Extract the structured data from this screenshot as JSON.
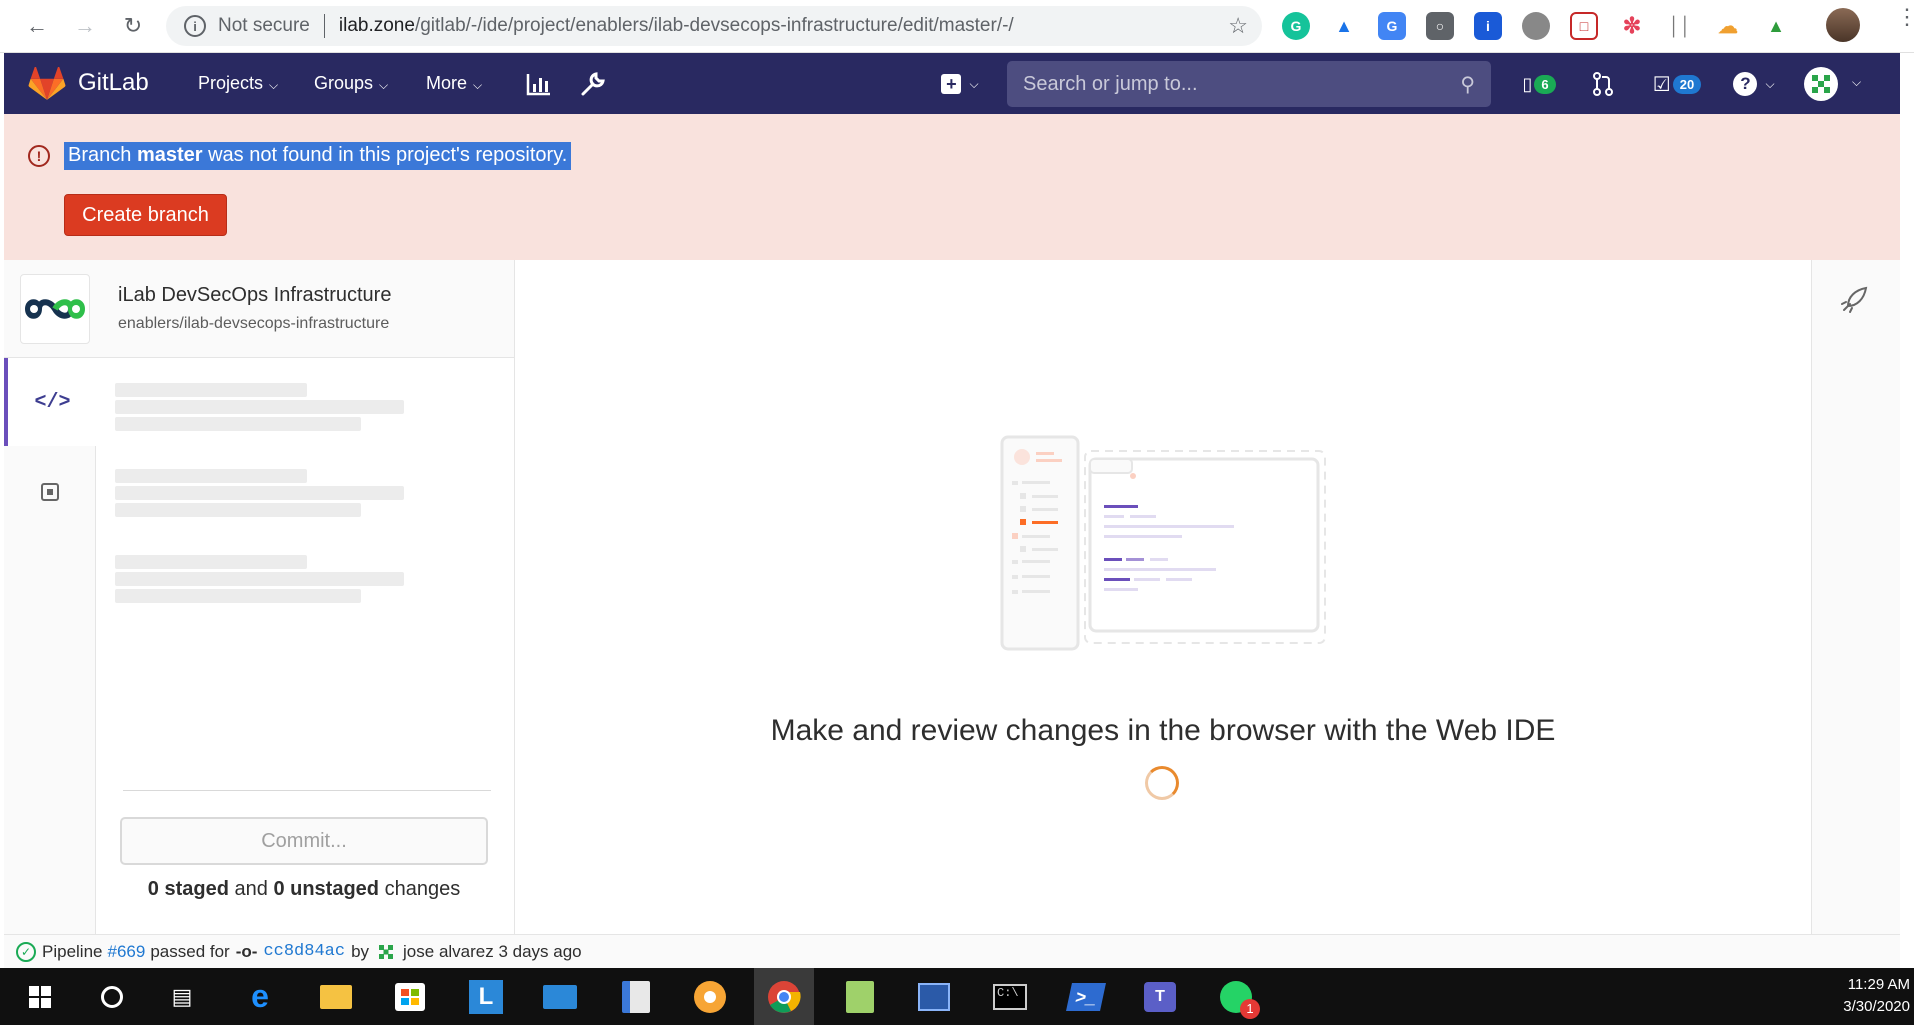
{
  "browser": {
    "security_label": "Not secure",
    "url_host": "ilab.zone",
    "url_path": "/gitlab/-/ide/project/enablers/ilab-devsecops-infrastructure/edit/master/-/"
  },
  "navbar": {
    "brand": "GitLab",
    "menus": [
      "Projects",
      "Groups",
      "More"
    ],
    "search_placeholder": "Search or jump to...",
    "issues_count": "6",
    "todos_count": "20",
    "colors": {
      "background": "#292961",
      "search": "#4d4d80",
      "issues_badge": "#1aaa55",
      "todos_badge": "#1f78d1"
    }
  },
  "alert": {
    "msg_prefix": "Branch ",
    "branch": "master",
    "msg_suffix": " was not found in this project's repository.",
    "button_label": "Create branch",
    "colors": {
      "background": "#f9e2dd",
      "button": "#db3b21"
    }
  },
  "project": {
    "name": "iLab DevSecOps Infrastructure",
    "path": "enablers/ilab-devsecops-infrastructure"
  },
  "sidebar": {
    "items": [
      {
        "name": "edit-icon",
        "active": true
      },
      {
        "name": "review-icon",
        "active": false
      }
    ]
  },
  "commit": {
    "button_label": "Commit...",
    "staged_count": "0 staged",
    "and_text": " and ",
    "unstaged_count": "0 unstaged",
    "changes_text": " changes"
  },
  "editor": {
    "empty_title": "Make and review changes in the browser with the Web IDE"
  },
  "status_bar": {
    "pipeline_label": "Pipeline",
    "pipeline_id": "#669",
    "passed_text": "passed for",
    "commit_sha": "cc8d84ac",
    "by_text": "by",
    "author_time": "jose alvarez 3 days ago"
  },
  "taskbar": {
    "time": "11:29 AM",
    "date": "3/30/2020",
    "whatsapp_badge": "1"
  }
}
